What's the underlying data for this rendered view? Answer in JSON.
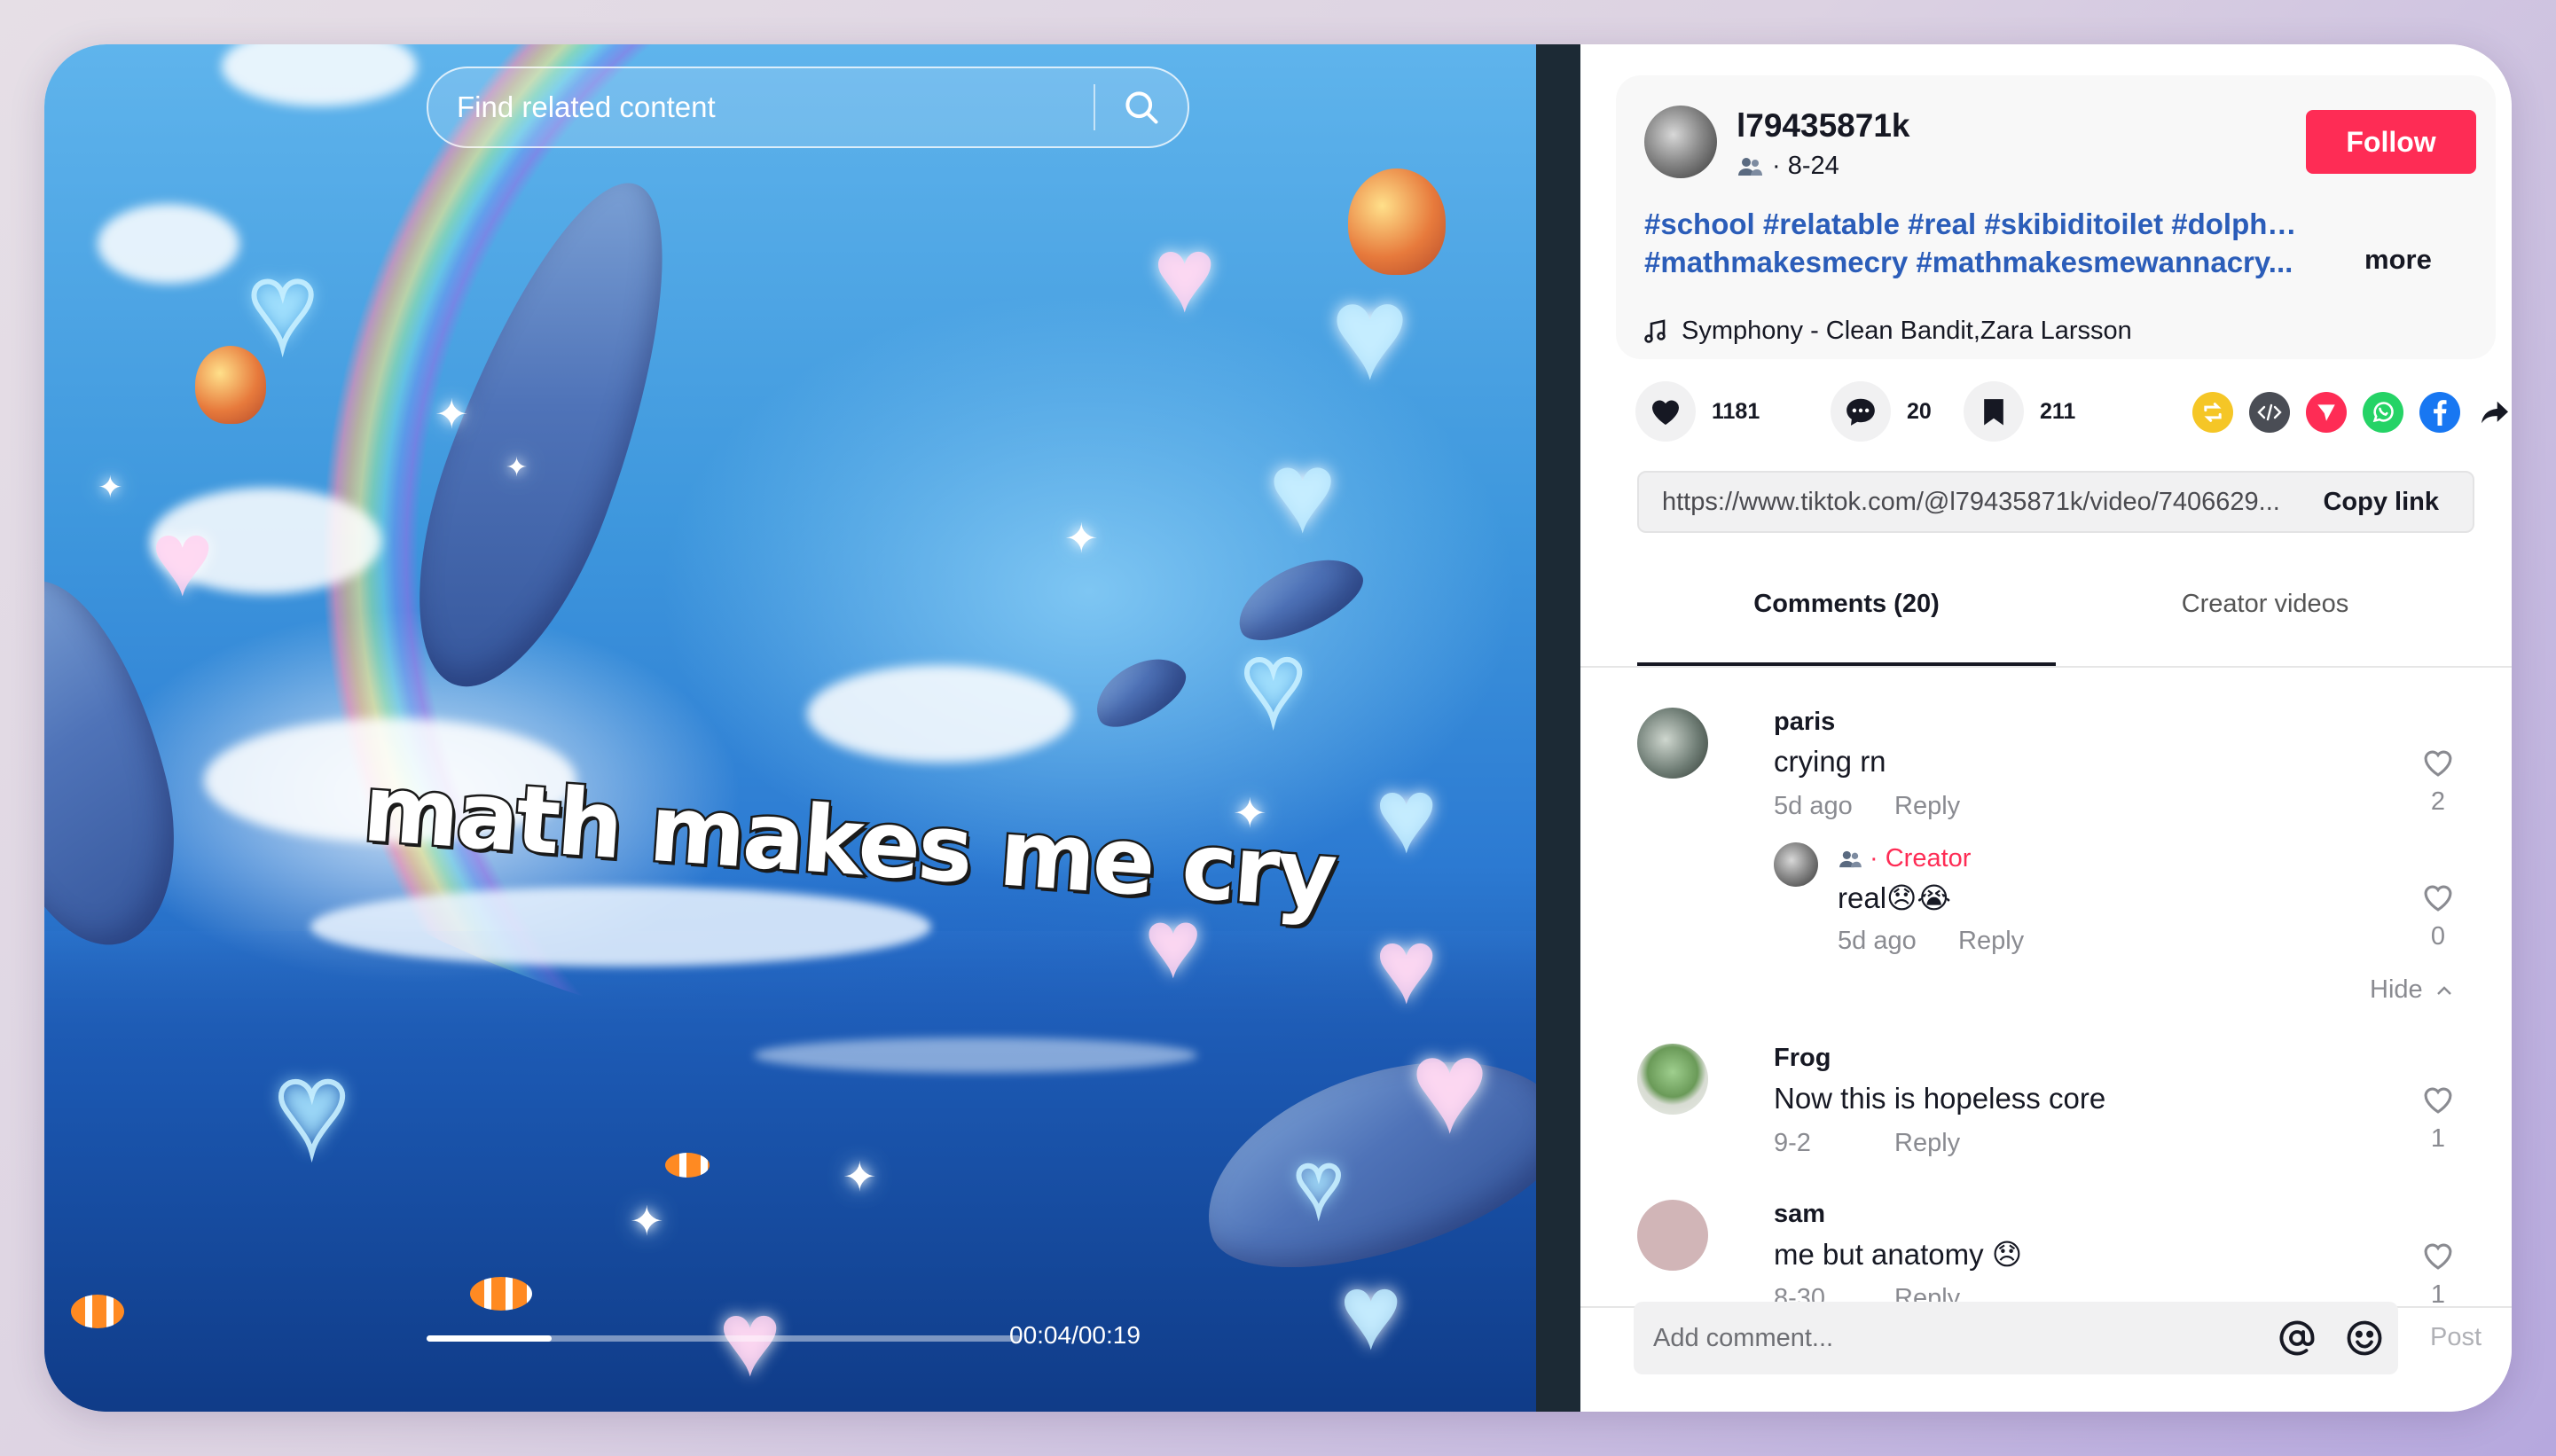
{
  "video": {
    "search_placeholder": "Find related content",
    "overlay_text": "math makes me cry",
    "time": "00:04/00:19",
    "progress": 0.21
  },
  "author": {
    "username": "l79435871k",
    "date": "· 8-24",
    "follow_label": "Follow"
  },
  "description": {
    "hashtags_line1": "#school #relatable #real #skibiditoilet #dolphins",
    "hashtags_line2": "#mathmakesmecry #mathmakesmewannacry...",
    "more_label": "more",
    "music": "Symphony - Clean Bandit,Zara Larsson"
  },
  "actions": {
    "likes": "1181",
    "comments": "20",
    "saves": "211"
  },
  "share_icons": [
    "repost-icon",
    "embed-icon",
    "send-icon",
    "whatsapp-icon",
    "facebook-icon",
    "share-arrow-icon"
  ],
  "link": {
    "url": "https://www.tiktok.com/@l79435871k/video/7406629...",
    "copy_label": "Copy link"
  },
  "tabs": {
    "comments": "Comments (20)",
    "creator_videos": "Creator videos"
  },
  "comments": [
    {
      "name": "paris",
      "text": "crying rn",
      "time": "5d ago",
      "reply": "Reply",
      "likes": "2"
    },
    {
      "name": "Frog",
      "text": "Now this is hopeless core",
      "time": "9-2",
      "reply": "Reply",
      "likes": "1"
    },
    {
      "name": "sam",
      "text": "me but anatomy 😞",
      "time": "8-30",
      "reply": "Reply",
      "likes": "1"
    }
  ],
  "reply_comment": {
    "tag": "· Creator",
    "text": "real😞😭",
    "time": "5d ago",
    "reply": "Reply",
    "likes": "0"
  },
  "hide_label": "Hide",
  "composer": {
    "placeholder": "Add comment...",
    "post_label": "Post"
  },
  "colors": {
    "accent": "#fe2c55",
    "hashtag": "#2b5db9",
    "muted": "#8a8b91"
  }
}
